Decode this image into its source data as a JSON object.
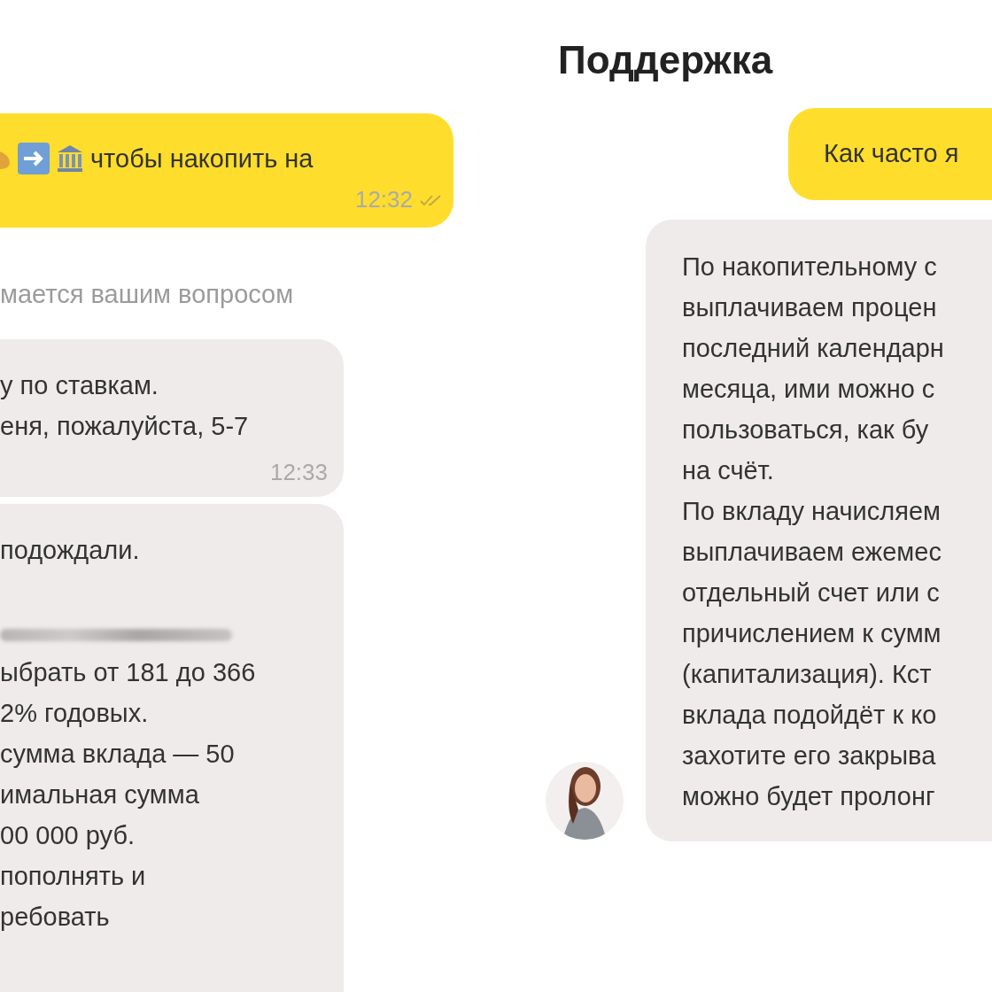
{
  "left_chat": {
    "messages": [
      {
        "kind": "outgoing",
        "emoji_prefix": true,
        "read": true,
        "time": "12:32",
        "lines": [
          {
            "kind": "text",
            "text": "чтобы накопить на"
          }
        ]
      },
      {
        "kind": "system",
        "lines": [
          {
            "kind": "text",
            "text": "мается вашим вопросом"
          }
        ]
      },
      {
        "kind": "incoming",
        "time": "12:33",
        "lines": [
          {
            "kind": "text",
            "text": "у по ставкам."
          },
          {
            "kind": "text",
            "text": "еня, пожалуйста, 5-7"
          }
        ]
      },
      {
        "kind": "incoming",
        "lines": [
          {
            "kind": "text",
            "text": "подождали."
          },
          {
            "kind": "blank"
          },
          {
            "kind": "redacted"
          },
          {
            "kind": "text",
            "text": "ыбрать от 181 до 366"
          },
          {
            "kind": "text",
            "text": "2% годовых."
          },
          {
            "kind": "text",
            "text": "сумма вклада — 50"
          },
          {
            "kind": "text",
            "text": "имальная сумма"
          },
          {
            "kind": "text",
            "text": "00 000 руб."
          },
          {
            "kind": "text",
            "text": "пополнять и"
          },
          {
            "kind": "text",
            "text": "ребовать"
          }
        ]
      }
    ]
  },
  "right_chat": {
    "title": "Поддержка",
    "messages": [
      {
        "kind": "outgoing",
        "lines": [
          {
            "kind": "text",
            "text": "Как часто я"
          }
        ]
      },
      {
        "kind": "incoming",
        "avatar": true,
        "lines": [
          {
            "kind": "text",
            "text": "По накопительному с"
          },
          {
            "kind": "text",
            "text": "выплачиваем процен"
          },
          {
            "kind": "text",
            "text": "последний календарн"
          },
          {
            "kind": "text",
            "text": "месяца, ими можно с"
          },
          {
            "kind": "text",
            "text": "пользоваться, как бу"
          },
          {
            "kind": "text",
            "text": "на счёт."
          },
          {
            "kind": "text",
            "text": "По вкладу начисляем"
          },
          {
            "kind": "text",
            "text": "выплачиваем ежемес"
          },
          {
            "kind": "text",
            "text": "отдельный счет или с"
          },
          {
            "kind": "text",
            "text": "причислением к сумм"
          },
          {
            "kind": "text",
            "text": "(капитализация). Кст"
          },
          {
            "kind": "text",
            "text": "вклада подойдёт к ко"
          },
          {
            "kind": "text",
            "text": "захотите его закрыва"
          },
          {
            "kind": "text",
            "text": "можно будет пролонг"
          }
        ]
      }
    ]
  }
}
